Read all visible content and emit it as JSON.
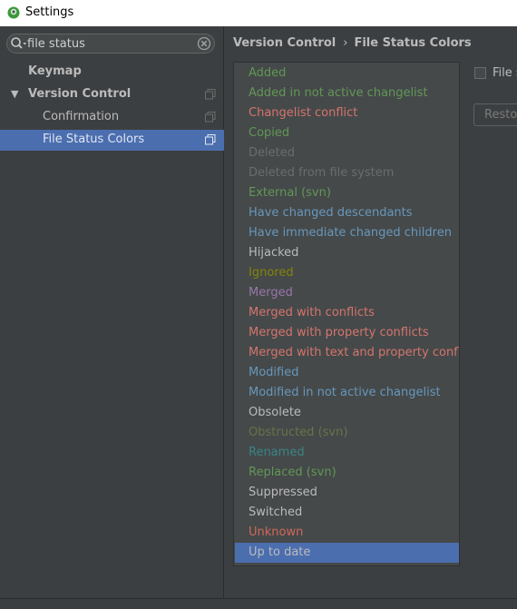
{
  "window": {
    "title": "Settings"
  },
  "search": {
    "value": "file status"
  },
  "tree": {
    "keymap": "Keymap",
    "version_control": "Version Control",
    "confirmation": "Confirmation",
    "file_status_colors": "File Status Colors"
  },
  "breadcrumb": {
    "parent": "Version Control",
    "separator": "›",
    "current": "File Status Colors"
  },
  "statuses": [
    {
      "label": "Added",
      "color": "#629755"
    },
    {
      "label": "Added in not active changelist",
      "color": "#629755"
    },
    {
      "label": "Changelist conflict",
      "color": "#d5756c"
    },
    {
      "label": "Copied",
      "color": "#629755"
    },
    {
      "label": "Deleted",
      "color": "#6c6c6c"
    },
    {
      "label": "Deleted from file system",
      "color": "#6c6c6c"
    },
    {
      "label": "External (svn)",
      "color": "#629755"
    },
    {
      "label": "Have changed descendants",
      "color": "#6897bb"
    },
    {
      "label": "Have immediate changed children",
      "color": "#6897bb"
    },
    {
      "label": "Hijacked",
      "color": "#bbbbbb"
    },
    {
      "label": "Ignored",
      "color": "#848504"
    },
    {
      "label": "Merged",
      "color": "#9876aa"
    },
    {
      "label": "Merged with conflicts",
      "color": "#d5756c"
    },
    {
      "label": "Merged with property conflicts",
      "color": "#d5756c"
    },
    {
      "label": "Merged with text and property conflicts",
      "color": "#d5756c"
    },
    {
      "label": "Modified",
      "color": "#6897bb"
    },
    {
      "label": "Modified in not active changelist",
      "color": "#6897bb"
    },
    {
      "label": "Obsolete",
      "color": "#bbbbbb"
    },
    {
      "label": "Obstructed (svn)",
      "color": "#6a7347"
    },
    {
      "label": "Renamed",
      "color": "#3a8484"
    },
    {
      "label": "Replaced (svn)",
      "color": "#629755"
    },
    {
      "label": "Suppressed",
      "color": "#bbbbbb"
    },
    {
      "label": "Switched",
      "color": "#bbbbbb"
    },
    {
      "label": "Unknown",
      "color": "#d1675a"
    },
    {
      "label": "Up to date",
      "color": "#bbbbbb"
    }
  ],
  "selected_status": "Up to date",
  "options": {
    "checkbox_label": "File s",
    "restore_label": "Resto"
  }
}
